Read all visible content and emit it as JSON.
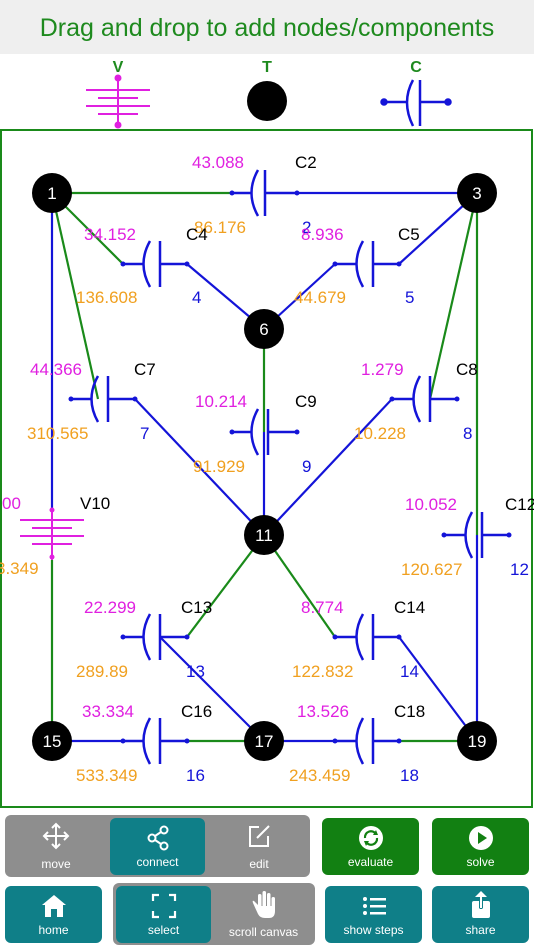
{
  "header": {
    "title": "Drag and drop to add nodes/components"
  },
  "palette": [
    {
      "label": "V",
      "kind": "voltage"
    },
    {
      "label": "T",
      "kind": "terminal"
    },
    {
      "label": "C",
      "kind": "capacitor"
    }
  ],
  "colors": {
    "title": "#1e8a1e",
    "wire_green": "#1a8a1a",
    "wire_blue": "#1414d8",
    "magenta": "#e020e0",
    "orange": "#f0a020",
    "teal": "#0f7f88",
    "green_btn": "#128012",
    "gray_group": "#8e8e8e"
  },
  "nodes": [
    {
      "id": "n1",
      "label": "1"
    },
    {
      "id": "n3",
      "label": "3"
    },
    {
      "id": "n6",
      "label": "6"
    },
    {
      "id": "n11",
      "label": "11"
    },
    {
      "id": "n15",
      "label": "15"
    },
    {
      "id": "n17",
      "label": "17"
    },
    {
      "id": "n19",
      "label": "19"
    }
  ],
  "components": [
    {
      "name": "C2",
      "top": "43.088",
      "bottom": "86.176",
      "index": "2"
    },
    {
      "name": "C4",
      "top": "34.152",
      "bottom": "136.608",
      "index": "4"
    },
    {
      "name": "C5",
      "top": "8.936",
      "bottom": "44.679",
      "index": "5"
    },
    {
      "name": "C7",
      "top": "44.366",
      "bottom": "310.565",
      "index": "7"
    },
    {
      "name": "C8",
      "top": "1.279",
      "bottom": "10.228",
      "index": "8"
    },
    {
      "name": "C9",
      "top": "10.214",
      "bottom": "91.929",
      "index": "9"
    },
    {
      "name": "V10",
      "top": "00",
      "bottom": "3.349",
      "index": ""
    },
    {
      "name": "C12",
      "top": "10.052",
      "bottom": "120.627",
      "index": "12"
    },
    {
      "name": "C13",
      "top": "22.299",
      "bottom": "289.89",
      "index": "13"
    },
    {
      "name": "C14",
      "top": "8.774",
      "bottom": "122.832",
      "index": "14"
    },
    {
      "name": "C16",
      "top": "33.334",
      "bottom": "533.349",
      "index": "16"
    },
    {
      "name": "C18",
      "top": "13.526",
      "bottom": "243.459",
      "index": "18"
    }
  ],
  "toolbar": {
    "move": {
      "label": "move",
      "icon": "move-arrows-icon"
    },
    "connect": {
      "label": "connect",
      "icon": "share-nodes-icon"
    },
    "edit": {
      "label": "edit",
      "icon": "pencil-square-icon"
    },
    "evaluate": {
      "label": "evaluate",
      "icon": "refresh-circle-icon"
    },
    "solve": {
      "label": "solve",
      "icon": "play-circle-icon"
    },
    "home": {
      "label": "home",
      "icon": "house-icon"
    },
    "select": {
      "label": "select",
      "icon": "select-frame-icon"
    },
    "scroll": {
      "label": "scroll canvas",
      "icon": "hand-icon"
    },
    "steps": {
      "label": "show steps",
      "icon": "list-icon"
    },
    "share": {
      "label": "share",
      "icon": "share-upload-icon"
    }
  }
}
